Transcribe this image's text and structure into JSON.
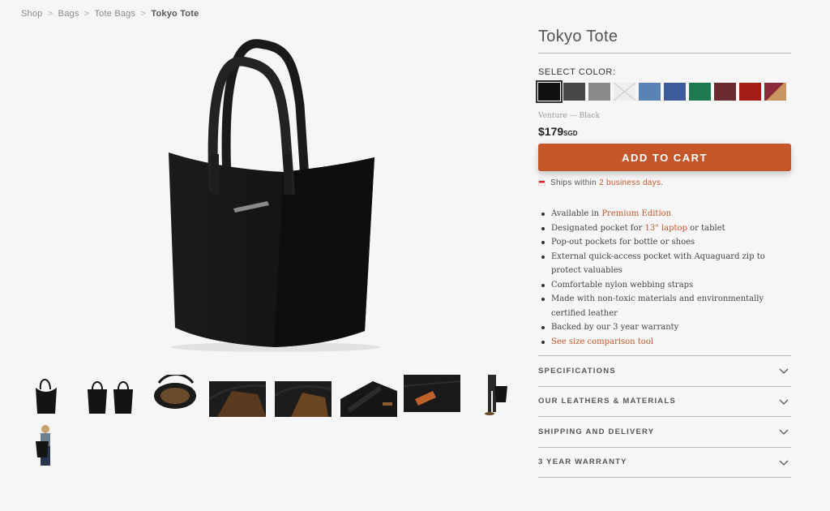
{
  "breadcrumb": {
    "items": [
      "Shop",
      "Bags",
      "Tote Bags"
    ],
    "separator": ">",
    "current": "Tokyo Tote"
  },
  "product": {
    "title": "Tokyo Tote",
    "select_color_label": "SELECT COLOR:",
    "swatches": [
      {
        "name": "black",
        "color": "#111111",
        "selected": true
      },
      {
        "name": "charcoal",
        "color": "#474747"
      },
      {
        "name": "grey",
        "color": "#8a8a8a"
      },
      {
        "name": "unavailable",
        "color": "#eeeeee"
      },
      {
        "name": "light-blue",
        "color": "#5b82b5"
      },
      {
        "name": "navy-blue",
        "color": "#3d5a9a"
      },
      {
        "name": "green",
        "color": "#1f7a4f"
      },
      {
        "name": "burgundy",
        "color": "#6b2a2e"
      },
      {
        "name": "red",
        "color": "#a31d14"
      },
      {
        "name": "red-tan",
        "color": "#8a2a3a"
      }
    ],
    "variant": "Venture — Black",
    "price": "$179",
    "currency": "SGD",
    "add_to_cart": "ADD TO CART",
    "ships": {
      "prefix": "Ships within",
      "highlight": "2 business days",
      "suffix": "."
    },
    "features": [
      {
        "text": "Available in ",
        "link": "Premium Edition",
        "after": ""
      },
      {
        "text": "Designated pocket for ",
        "link": "13\" laptop",
        "after": " or tablet"
      },
      {
        "text": "Pop-out pockets for bottle or shoes"
      },
      {
        "text": "External quick-access pocket with Aquaguard zip to protect valuables"
      },
      {
        "text": "Comfortable nylon webbing straps"
      },
      {
        "text": "Made with non-toxic materials and environmentally certified leather"
      },
      {
        "text": "Backed by our 3 year warranty"
      },
      {
        "text": "",
        "link": "See size comparison tool",
        "after": ""
      }
    ],
    "accordion": [
      "SPECIFICATIONS",
      "OUR LEATHERS & MATERIALS",
      "SHIPPING AND DELIVERY",
      "3 YEAR WARRANTY"
    ]
  },
  "colors": {
    "accent": "#c4562a",
    "bag": "#141414"
  },
  "thumbnails": [
    "front",
    "pair",
    "interior-top",
    "interior-open",
    "interior-pocket",
    "side-strap",
    "quick-access-pocket",
    "model-side",
    "model-front"
  ],
  "active_thumbnail": 0
}
